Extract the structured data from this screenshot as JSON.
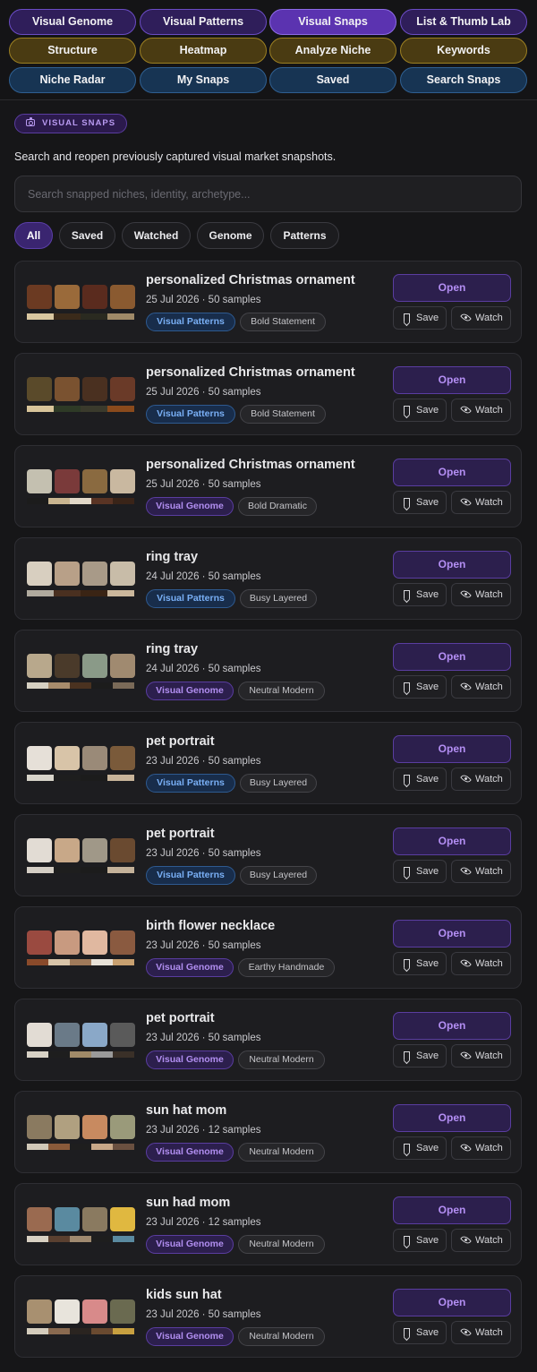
{
  "tabs": [
    {
      "label": "Visual Genome",
      "group": "purple"
    },
    {
      "label": "Visual Patterns",
      "group": "purple"
    },
    {
      "label": "Visual Snaps",
      "group": "purple",
      "active": true
    },
    {
      "label": "List & Thumb Lab",
      "group": "purple"
    },
    {
      "label": "Structure",
      "group": "olive"
    },
    {
      "label": "Heatmap",
      "group": "olive"
    },
    {
      "label": "Analyze Niche",
      "group": "olive"
    },
    {
      "label": "Keywords",
      "group": "olive"
    },
    {
      "label": "Niche Radar",
      "group": "blue"
    },
    {
      "label": "My Snaps",
      "group": "blue"
    },
    {
      "label": "Saved",
      "group": "blue"
    },
    {
      "label": "Search Snaps",
      "group": "blue"
    }
  ],
  "section": {
    "badge": "VISUAL SNAPS",
    "badge_icon": "camera-icon",
    "description": "Search and reopen previously captured visual market snapshots."
  },
  "search": {
    "placeholder": "Search snapped niches, identity, archetype...",
    "value": ""
  },
  "filters": [
    {
      "label": "All",
      "active": true
    },
    {
      "label": "Saved"
    },
    {
      "label": "Watched"
    },
    {
      "label": "Genome"
    },
    {
      "label": "Patterns"
    }
  ],
  "buttons": {
    "open": "Open",
    "save": "Save",
    "watch": "Watch"
  },
  "snaps": [
    {
      "title": "personalized Christmas ornament",
      "meta": "25 Jul 2026 · 50 samples",
      "source": "Visual Patterns",
      "style": "Bold Statement",
      "thumbs": [
        "#6b3a22",
        "#9a6a3a",
        "#5a2b1e",
        "#8a5a30"
      ],
      "swatches": [
        "#d9c7a0",
        "#3a2a1a",
        "#2a2a20",
        "#a08a68"
      ]
    },
    {
      "title": "personalized Christmas ornament",
      "meta": "25 Jul 2026 · 50 samples",
      "source": "Visual Patterns",
      "style": "Bold Statement",
      "thumbs": [
        "#5a4a2a",
        "#7a5230",
        "#4a3020",
        "#6a3a28"
      ],
      "swatches": [
        "#d8c49a",
        "#2e3a26",
        "#3a3a2c",
        "#8a4a1c"
      ]
    },
    {
      "title": "personalized Christmas ornament",
      "meta": "25 Jul 2026 · 50 samples",
      "source": "Visual Genome",
      "style": "Bold Dramatic",
      "thumbs": [
        "#c4c0b0",
        "#7a3a3a",
        "#8a6a40",
        "#c9b8a0"
      ],
      "swatches": [
        "#1c1c1c",
        "#c9b590",
        "#e2d8c8",
        "#5a3424",
        "#3a2418"
      ]
    },
    {
      "title": "ring tray",
      "meta": "24 Jul 2026 · 50 samples",
      "source": "Visual Patterns",
      "style": "Busy Layered",
      "thumbs": [
        "#d8cfc0",
        "#b8a088",
        "#a89a88",
        "#c8bca8"
      ],
      "swatches": [
        "#b0aa9e",
        "#4a3020",
        "#3a2414",
        "#cbb79c"
      ]
    },
    {
      "title": "ring tray",
      "meta": "24 Jul 2026 · 50 samples",
      "source": "Visual Genome",
      "style": "Neutral Modern",
      "thumbs": [
        "#b8a88c",
        "#4a3a2a",
        "#8a9a88",
        "#a08a70"
      ],
      "swatches": [
        "#d6d0c2",
        "#a88c6c",
        "#4a3220",
        "#1c1c1c",
        "#7a6a58"
      ]
    },
    {
      "title": "pet portrait",
      "meta": "23 Jul 2026 · 50 samples",
      "source": "Visual Patterns",
      "style": "Busy Layered",
      "thumbs": [
        "#e6e0d8",
        "#d8c4a8",
        "#9a8a78",
        "#7a5a3a"
      ],
      "swatches": [
        "#d8d4ca",
        "#1e1e1e",
        "#1c1c1c",
        "#c8b49a"
      ]
    },
    {
      "title": "pet portrait",
      "meta": "23 Jul 2026 · 50 samples",
      "source": "Visual Patterns",
      "style": "Busy Layered",
      "thumbs": [
        "#e2dcd4",
        "#c8a888",
        "#a09888",
        "#6a4a30"
      ],
      "swatches": [
        "#d4cec4",
        "#1e1e1e",
        "#1c1c1c",
        "#c4b29a"
      ]
    },
    {
      "title": "birth flower necklace",
      "meta": "23 Jul 2026 · 50 samples",
      "source": "Visual Genome",
      "style": "Earthy Handmade",
      "thumbs": [
        "#9a4a40",
        "#c89a80",
        "#e0b8a0",
        "#8a5a40"
      ],
      "swatches": [
        "#8a4a2a",
        "#d8c4a8",
        "#a07a5a",
        "#e8e2d8",
        "#c8a070"
      ]
    },
    {
      "title": "pet portrait",
      "meta": "23 Jul 2026 · 50 samples",
      "source": "Visual Genome",
      "style": "Neutral Modern",
      "thumbs": [
        "#e2dcd4",
        "#6a7a88",
        "#8aa8c8",
        "#5a5a5a"
      ],
      "swatches": [
        "#d8d2c6",
        "#1e1e1e",
        "#a08a68",
        "#9a9a9a",
        "#3a3028"
      ]
    },
    {
      "title": "sun hat mom",
      "meta": "23 Jul 2026 · 12 samples",
      "source": "Visual Genome",
      "style": "Neutral Modern",
      "thumbs": [
        "#8a7a60",
        "#b0a080",
        "#c88a60",
        "#9a9a7a"
      ],
      "swatches": [
        "#d0c8b8",
        "#8a5a3a",
        "#1e1e1e",
        "#c8a888",
        "#6a5040"
      ]
    },
    {
      "title": "sun had mom",
      "meta": "23 Jul 2026 · 12 samples",
      "source": "Visual Genome",
      "style": "Neutral Modern",
      "thumbs": [
        "#9a6a50",
        "#5a8aa0",
        "#8a7a60",
        "#e0b840"
      ],
      "swatches": [
        "#d8d0c2",
        "#5a4030",
        "#a08a70",
        "#1e1e1e",
        "#5a8aa0"
      ]
    },
    {
      "title": "kids sun hat",
      "meta": "23 Jul 2026 · 50 samples",
      "source": "Visual Genome",
      "style": "Neutral Modern",
      "thumbs": [
        "#a89070",
        "#e8e4dc",
        "#d88a8a",
        "#6a6a50"
      ],
      "swatches": [
        "#d4ccbc",
        "#8a6a50",
        "#2a2420",
        "#6a4a30",
        "#c8a040"
      ]
    }
  ]
}
